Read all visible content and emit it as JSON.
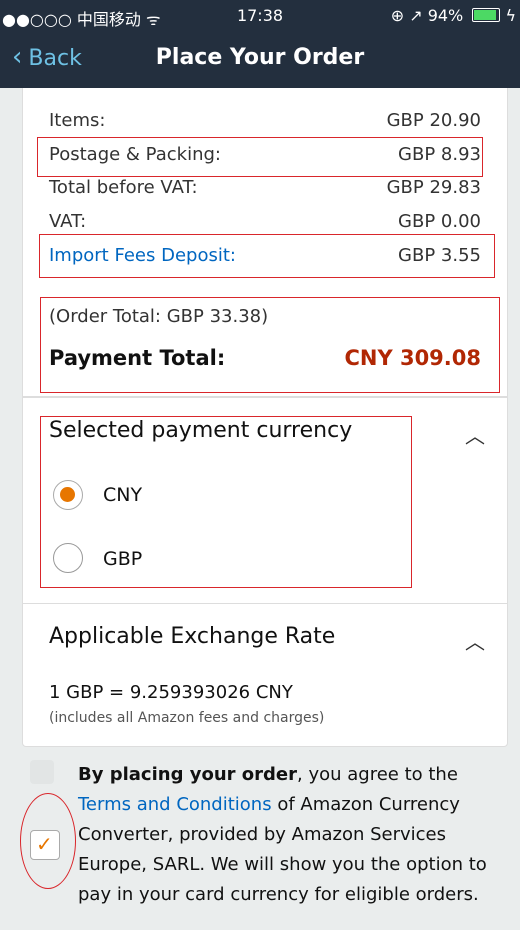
{
  "status_bar": {
    "carrier": "●●○○○ 中国移动 ᯤ",
    "time": "17:38",
    "right_text": "⊕ ↗ 94%",
    "battery_percent": 94
  },
  "nav": {
    "back_label": "Back",
    "title": "Place Your Order"
  },
  "summary": {
    "rows": [
      {
        "label": "Items:",
        "value": "GBP 20.90"
      },
      {
        "label": "Postage & Packing:",
        "value": "GBP 8.93"
      },
      {
        "label": "Total before VAT:",
        "value": "GBP 29.83"
      },
      {
        "label": "VAT:",
        "value": "GBP 0.00"
      },
      {
        "label": "Import Fees Deposit:",
        "value": "GBP 3.55"
      }
    ],
    "order_total_note": "(Order Total: GBP 33.38)",
    "payment_total_label": "Payment Total:",
    "payment_total_value": "CNY 309.08"
  },
  "currency": {
    "title": "Selected payment currency",
    "options": [
      {
        "label": "CNY",
        "selected": true
      },
      {
        "label": "GBP",
        "selected": false
      }
    ]
  },
  "exchange": {
    "title": "Applicable Exchange Rate",
    "rate": "1 GBP = 9.259393026 CNY",
    "note": "(includes all Amazon fees and charges)"
  },
  "agreement": {
    "checked": true,
    "bold_lead": "By placing your order",
    "text_1": ", you agree to the ",
    "link": "Terms and Conditions",
    "text_2": " of Amazon Currency Converter, provided by Amazon Services Europe, SARL. We will show you the option to pay in your card currency for eligible orders."
  },
  "colors": {
    "header_bg": "#232f3e",
    "link": "#0066c0",
    "price_red": "#b12704",
    "accent_orange": "#e77600",
    "annotation_red": "#d9262b"
  }
}
